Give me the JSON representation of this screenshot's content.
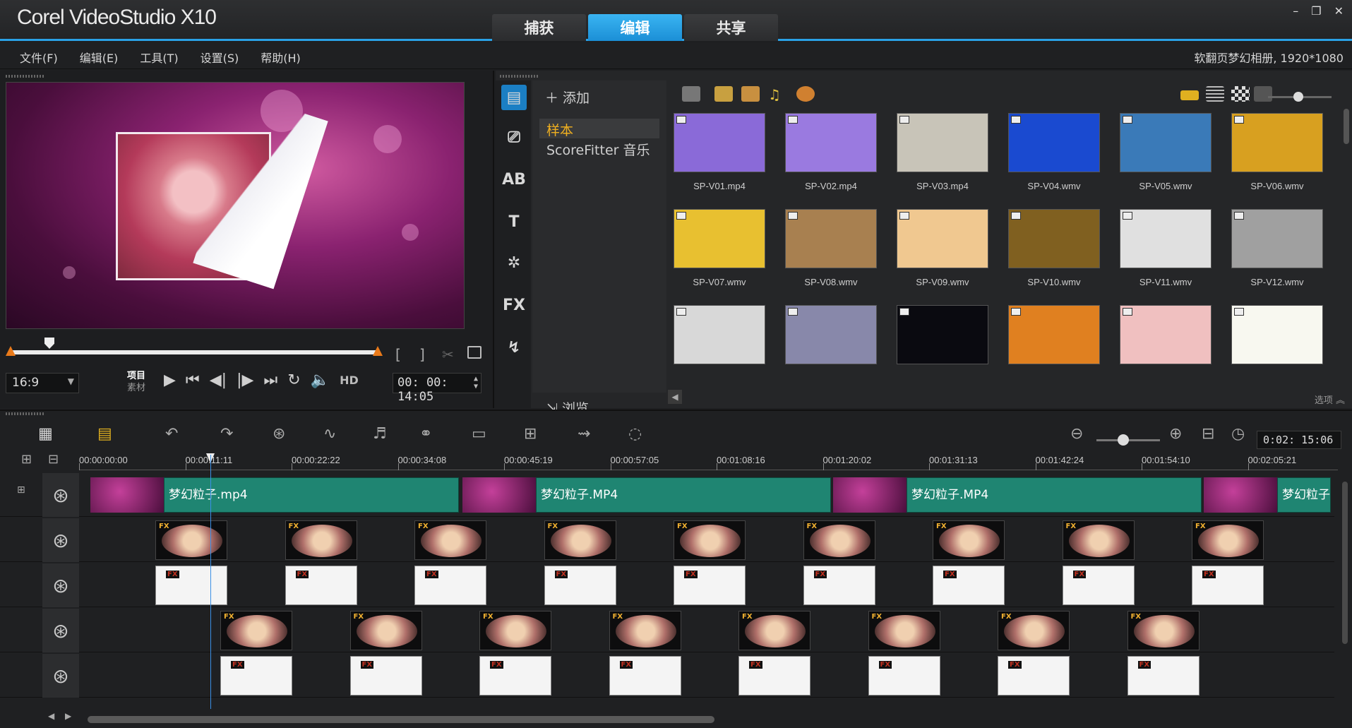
{
  "app": {
    "title": "Corel VideoStudio X10",
    "tabs": [
      {
        "label": "捕获",
        "active": false
      },
      {
        "label": "编辑",
        "active": true
      },
      {
        "label": "共享",
        "active": false
      }
    ],
    "accent_color": "#2aa1e6",
    "window_controls": {
      "minimize": "–",
      "restore": "❐",
      "close": "✕"
    }
  },
  "menubar": {
    "items": [
      "文件(F)",
      "编辑(E)",
      "工具(T)",
      "设置(S)",
      "帮助(H)"
    ],
    "project_info": "软翻页梦幻相册, 1920*1080"
  },
  "player": {
    "aspect_ratio": "16:9",
    "mode_project": "项目",
    "mode_clip": "素材",
    "hd_label": "HD",
    "timecode": "00:00:14:05",
    "timecode_display": "00: 00: 14:05",
    "mark_in": "[",
    "mark_out": "]"
  },
  "library": {
    "add_label": "添加",
    "folders": [
      {
        "label": "样本",
        "selected": true
      },
      {
        "label": "ScoreFitter 音乐",
        "selected": false
      }
    ],
    "browse_label": "浏览",
    "options_label": "选项",
    "side_tools": [
      "media-icon",
      "instant-project-icon",
      "transition-icon",
      "title-icon",
      "graphics-icon",
      "filter-icon",
      "path-icon"
    ],
    "thumbnails": [
      {
        "name": "SP-V01.mp4",
        "color": "#8a6ad8"
      },
      {
        "name": "SP-V02.mp4",
        "color": "#9a7ae0"
      },
      {
        "name": "SP-V03.mp4",
        "color": "#c8c4b8"
      },
      {
        "name": "SP-V04.wmv",
        "color": "#1a4ad0"
      },
      {
        "name": "SP-V05.wmv",
        "color": "#3a7ab8"
      },
      {
        "name": "SP-V06.wmv",
        "color": "#d8a020"
      },
      {
        "name": "SP-V07.wmv",
        "color": "#e8c030"
      },
      {
        "name": "SP-V08.wmv",
        "color": "#a88050"
      },
      {
        "name": "SP-V09.wmv",
        "color": "#f0c890"
      },
      {
        "name": "SP-V10.wmv",
        "color": "#806020"
      },
      {
        "name": "SP-V11.wmv",
        "color": "#e0e0e0"
      },
      {
        "name": "SP-V12.wmv",
        "color": "#a0a0a0"
      },
      {
        "name": "",
        "color": "#d8d8d8"
      },
      {
        "name": "",
        "color": "#8888aa"
      },
      {
        "name": "",
        "color": "#0a0a10"
      },
      {
        "name": "",
        "color": "#e08020"
      },
      {
        "name": "",
        "color": "#f0c0c0"
      },
      {
        "name": "",
        "color": "#f8f8f0"
      }
    ]
  },
  "timeline": {
    "duration": "0:02: 15:06",
    "ruler_labels": [
      "00:00:00:00",
      "00:00:11:11",
      "00:00:22:22",
      "00:00:34:08",
      "00:00:45:19",
      "00:00:57:05",
      "00:01:08:16",
      "00:01:20:02",
      "00:01:31:13",
      "00:01:42:24",
      "00:01:54:10",
      "00:02:05:21"
    ],
    "video_clips": [
      "梦幻粒子.mp4",
      "梦幻粒子.MP4",
      "梦幻粒子.MP4",
      "梦幻粒子"
    ],
    "fx_label": "FX"
  }
}
